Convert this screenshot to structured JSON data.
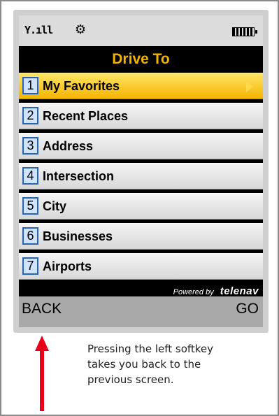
{
  "status": {
    "signal_text": "Y.ıll",
    "gear_icon": "gear-icon",
    "battery_icon": "battery-icon"
  },
  "title": "Drive To",
  "menu": [
    {
      "number": "1",
      "label": "My Favorites",
      "selected": true
    },
    {
      "number": "2",
      "label": "Recent Places",
      "selected": false
    },
    {
      "number": "3",
      "label": "Address",
      "selected": false
    },
    {
      "number": "4",
      "label": "Intersection",
      "selected": false
    },
    {
      "number": "5",
      "label": "City",
      "selected": false
    },
    {
      "number": "6",
      "label": "Businesses",
      "selected": false
    },
    {
      "number": "7",
      "label": "Airports",
      "selected": false
    }
  ],
  "powered": {
    "prefix": "Powered by",
    "brand": "telenav"
  },
  "softkeys": {
    "left": "BACK",
    "right": "GO"
  },
  "caption": {
    "line1": "Pressing the left softkey",
    "line2": "takes you back to the",
    "line3": "previous screen."
  },
  "colors": {
    "title": "#f0b400",
    "selected": "#f5b400",
    "arrow": "#e8001a"
  }
}
